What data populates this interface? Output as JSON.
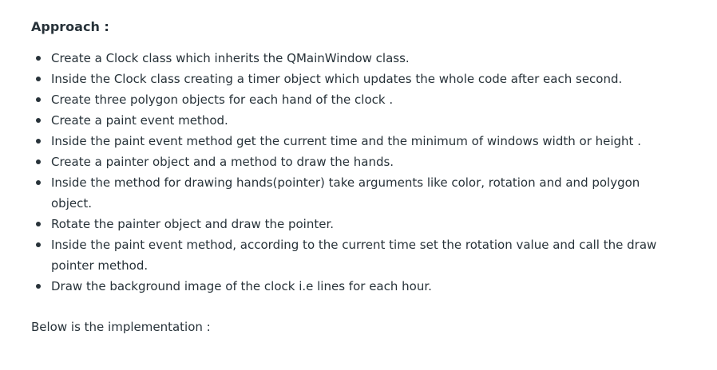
{
  "heading": "Approach :",
  "steps": [
    "Create a Clock class which inherits the QMainWindow class.",
    "Inside the Clock class creating a timer object which updates the whole code after each second.",
    "Create three polygon objects for each hand of the clock .",
    "Create a paint event method.",
    "Inside the paint event method get the current time and the minimum of windows width or height .",
    "Create a painter object and a method to draw the hands.",
    "Inside the method for drawing hands(pointer) take arguments like color, rotation and and polygon object.",
    "Rotate the painter object and draw the pointer.",
    "Inside the paint event method, according to the current time set the rotation value and call the draw pointer method.",
    "Draw the background image of the clock i.e lines for each hour."
  ],
  "footer": "Below is the implementation :"
}
